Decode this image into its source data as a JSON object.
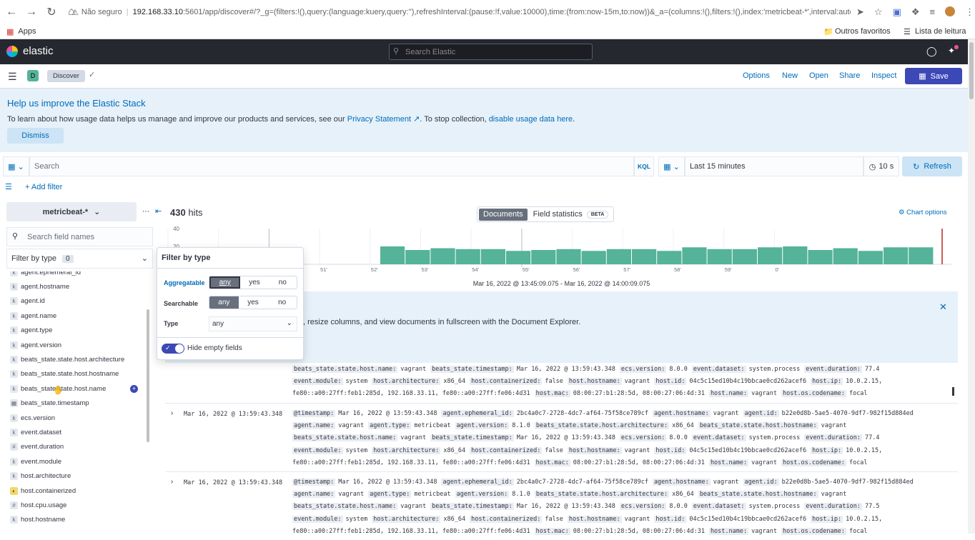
{
  "browser": {
    "security_label": "Não seguro",
    "url_host": "192.168.33.10",
    "url_rest": ":5601/app/discover#/?_g=(filters:!(),query:(language:kuery,query:''),refreshInterval:(pause:!f,value:10000),time:(from:now-15m,to:now))&_a=(columns:!(),filters:!(),index:'metricbeat-*',interval:auto,query:(langu...",
    "apps_label": "Apps",
    "other_favorites": "Outros favoritos",
    "reading_list": "Lista de leitura"
  },
  "header": {
    "logo_text": "elastic",
    "search_placeholder": "Search Elastic"
  },
  "app_bar": {
    "space_letter": "D",
    "breadcrumb": "Discover",
    "options": "Options",
    "new": "New",
    "open": "Open",
    "share": "Share",
    "inspect": "Inspect",
    "save": "Save"
  },
  "callout": {
    "title": "Help us improve the Elastic Stack",
    "text_before": "To learn about how usage data helps us manage and improve our products and services, see our ",
    "privacy_link": "Privacy Statement",
    "text_middle": ". To stop collection, ",
    "disable_link": "disable usage data here",
    "text_after": ".",
    "dismiss": "Dismiss"
  },
  "query_bar": {
    "search_placeholder": "Search",
    "language": "KQL",
    "time_label": "Last 15 minutes",
    "refresh_interval": "10 s",
    "refresh": "Refresh",
    "add_filter": "+ Add filter"
  },
  "sidebar": {
    "index_pattern": "metricbeat-*",
    "field_search_placeholder": "Search field names",
    "filter_by_type": "Filter by type",
    "filter_count": "0",
    "fields": [
      {
        "name": "agent.ephemeral_id",
        "type": "k"
      },
      {
        "name": "agent.hostname",
        "type": "k"
      },
      {
        "name": "agent.id",
        "type": "k"
      },
      {
        "name": "agent.name",
        "type": "k"
      },
      {
        "name": "agent.type",
        "type": "k"
      },
      {
        "name": "agent.version",
        "type": "k"
      },
      {
        "name": "beats_state.state.host.architecture",
        "type": "k"
      },
      {
        "name": "beats_state.state.host.hostname",
        "type": "k"
      },
      {
        "name": "beats_state.state.host.name",
        "type": "k"
      },
      {
        "name": "beats_state.timestamp",
        "type": "date"
      },
      {
        "name": "ecs.version",
        "type": "k"
      },
      {
        "name": "event.dataset",
        "type": "k"
      },
      {
        "name": "event.duration",
        "type": "#"
      },
      {
        "name": "event.module",
        "type": "k"
      },
      {
        "name": "host.architecture",
        "type": "k"
      },
      {
        "name": "host.containerized",
        "type": "bool"
      },
      {
        "name": "host.cpu.usage",
        "type": "#"
      },
      {
        "name": "host.hostname",
        "type": "k"
      }
    ]
  },
  "main": {
    "hits_count": "430",
    "hits_label": "hits",
    "tab_documents": "Documents",
    "tab_field_stats": "Field statistics",
    "beta": "BETA",
    "chart_options": "Chart options",
    "time_range": "Mar 16, 2022 @ 13:45:09.075 - Mar 16, 2022 @ 14:00:09.075",
    "doc_callout_text": ", resize columns, and view documents in fullscreen with the Document Explorer."
  },
  "chart_data": {
    "type": "bar",
    "ylim": [
      0,
      40
    ],
    "yticks": [
      "40",
      "20"
    ],
    "xticks": [
      "48'",
      "49'",
      "50'",
      "51'",
      "52'",
      "53'",
      "54'",
      "55'",
      "56'",
      "57'",
      "58'",
      "59'",
      "0'"
    ],
    "categories": [
      "13:49:00",
      "13:49:30",
      "13:50:00",
      "13:50:30",
      "13:51:00",
      "13:51:30",
      "13:52:00",
      "13:52:30",
      "13:53:00",
      "13:53:30",
      "13:54:00",
      "13:54:30",
      "13:55:00",
      "13:55:30",
      "13:56:00",
      "13:56:30",
      "13:57:00",
      "13:57:30",
      "13:58:00",
      "13:58:30",
      "13:59:00",
      "13:59:30"
    ],
    "values": [
      20,
      16,
      18,
      17,
      17,
      15,
      16,
      17,
      15,
      17,
      17,
      15,
      19,
      17,
      17,
      19,
      20,
      16,
      18,
      15,
      19,
      19
    ],
    "color": "#54b399"
  },
  "popover": {
    "title": "Filter by type",
    "aggregatable": "Aggregatable",
    "searchable": "Searchable",
    "type": "Type",
    "any": "any",
    "yes": "yes",
    "no": "no",
    "type_value": "any",
    "hide_empty": "Hide empty fields"
  },
  "documents": [
    {
      "time": "",
      "lines": [
        [
          [
            "beats_state.state.host.name:",
            "vagrant"
          ],
          [
            "beats_state.timestamp:",
            "Mar 16, 2022 @ 13:59:43.348"
          ],
          [
            "ecs.version:",
            "8.0.0"
          ],
          [
            "event.dataset:",
            "system.process"
          ],
          [
            "event.duration:",
            "77.4"
          ]
        ],
        [
          [
            "event.module:",
            "system"
          ],
          [
            "host.architecture:",
            "x86_64"
          ],
          [
            "host.containerized:",
            "false"
          ],
          [
            "host.hostname:",
            "vagrant"
          ],
          [
            "host.id:",
            "04c5c15ed10b4c19bbcae0cd262acef6"
          ],
          [
            "host.ip:",
            "10.0.2.15,"
          ]
        ],
        [
          [
            "",
            "fe80::a00:27ff:feb1:285d, 192.168.33.11, fe80::a00:27ff:fe06:4d31"
          ],
          [
            "host.mac:",
            "08:00:27:b1:28:5d, 08:00:27:06:4d:31"
          ],
          [
            "host.name:",
            "vagrant"
          ],
          [
            "host.os.codename:",
            "focal"
          ]
        ]
      ]
    },
    {
      "time": "Mar 16, 2022 @ 13:59:43.348",
      "lines": [
        [
          [
            "@timestamp:",
            "Mar 16, 2022 @ 13:59:43.348"
          ],
          [
            "agent.ephemeral_id:",
            "2bc4a0c7-2728-4dc7-af64-75f58ce789cf"
          ],
          [
            "agent.hostname:",
            "vagrant"
          ],
          [
            "agent.id:",
            "b22e0d8b-5ae5-4070-9df7-982f15d884ed"
          ]
        ],
        [
          [
            "agent.name:",
            "vagrant"
          ],
          [
            "agent.type:",
            "metricbeat"
          ],
          [
            "agent.version:",
            "8.1.0"
          ],
          [
            "beats_state.state.host.architecture:",
            "x86_64"
          ],
          [
            "beats_state.state.host.hostname:",
            "vagrant"
          ]
        ],
        [
          [
            "beats_state.state.host.name:",
            "vagrant"
          ],
          [
            "beats_state.timestamp:",
            "Mar 16, 2022 @ 13:59:43.348"
          ],
          [
            "ecs.version:",
            "8.0.0"
          ],
          [
            "event.dataset:",
            "system.process"
          ],
          [
            "event.duration:",
            "77.4"
          ]
        ],
        [
          [
            "event.module:",
            "system"
          ],
          [
            "host.architecture:",
            "x86_64"
          ],
          [
            "host.containerized:",
            "false"
          ],
          [
            "host.hostname:",
            "vagrant"
          ],
          [
            "host.id:",
            "04c5c15ed10b4c19bbcae0cd262acef6"
          ],
          [
            "host.ip:",
            "10.0.2.15,"
          ]
        ],
        [
          [
            "",
            "fe80::a00:27ff:feb1:285d, 192.168.33.11, fe80::a00:27ff:fe06:4d31"
          ],
          [
            "host.mac:",
            "08:00:27:b1:28:5d, 08:00:27:06:4d:31"
          ],
          [
            "host.name:",
            "vagrant"
          ],
          [
            "host.os.codename:",
            "focal"
          ]
        ]
      ]
    },
    {
      "time": "Mar 16, 2022 @ 13:59:43.348",
      "lines": [
        [
          [
            "@timestamp:",
            "Mar 16, 2022 @ 13:59:43.348"
          ],
          [
            "agent.ephemeral_id:",
            "2bc4a0c7-2728-4dc7-af64-75f58ce789cf"
          ],
          [
            "agent.hostname:",
            "vagrant"
          ],
          [
            "agent.id:",
            "b22e0d8b-5ae5-4070-9df7-982f15d884ed"
          ]
        ],
        [
          [
            "agent.name:",
            "vagrant"
          ],
          [
            "agent.type:",
            "metricbeat"
          ],
          [
            "agent.version:",
            "8.1.0"
          ],
          [
            "beats_state.state.host.architecture:",
            "x86_64"
          ],
          [
            "beats_state.state.host.hostname:",
            "vagrant"
          ]
        ],
        [
          [
            "beats_state.state.host.name:",
            "vagrant"
          ],
          [
            "beats_state.timestamp:",
            "Mar 16, 2022 @ 13:59:43.348"
          ],
          [
            "ecs.version:",
            "8.0.0"
          ],
          [
            "event.dataset:",
            "system.process"
          ],
          [
            "event.duration:",
            "77.5"
          ]
        ],
        [
          [
            "event.module:",
            "system"
          ],
          [
            "host.architecture:",
            "x86_64"
          ],
          [
            "host.containerized:",
            "false"
          ],
          [
            "host.hostname:",
            "vagrant"
          ],
          [
            "host.id:",
            "04c5c15ed10b4c19bbcae0cd262acef6"
          ],
          [
            "host.ip:",
            "10.0.2.15,"
          ]
        ],
        [
          [
            "",
            "fe80::a00:27ff:feb1:285d, 192.168.33.11, fe80::a00:27ff:fe06:4d31"
          ],
          [
            "host.mac:",
            "08:00:27:b1:28:5d, 08:00:27:06:4d:31"
          ],
          [
            "host.name:",
            "vagrant"
          ],
          [
            "host.os.codename:",
            "focal"
          ]
        ]
      ]
    }
  ]
}
